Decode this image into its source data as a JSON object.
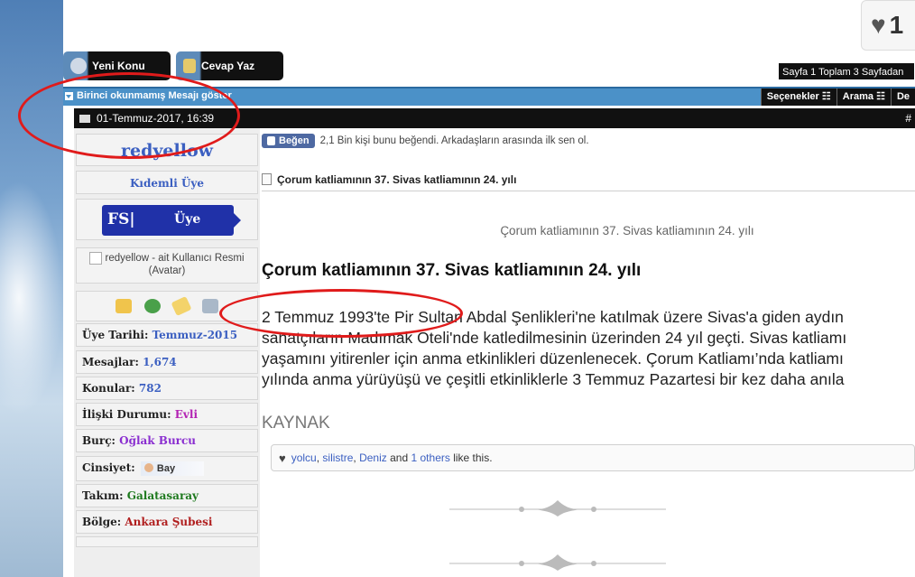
{
  "top_widget": {
    "icon": "heart-icon",
    "count": "1"
  },
  "toolbar": {
    "new_thread": "Yeni Konu",
    "reply": "Cevap Yaz"
  },
  "pagination": "Sayfa 1 Toplam 3 Sayfadan",
  "navbar": {
    "first_unread": "Birinci okunmamış Mesajı göster",
    "tools": [
      "Seçenekler",
      "Arama",
      "De"
    ]
  },
  "post": {
    "date": "01-Temmuz-2017, 16:39",
    "hash": "#"
  },
  "user": {
    "name": "redyellow",
    "title": "Kıdemli Üye",
    "rank_left": "FS|",
    "rank_right": "Üye",
    "avatar_alt": "redyellow - ait Kullanıcı Resmi (Avatar)",
    "info": [
      {
        "label": "Üye Tarihi:",
        "value": "Temmuz-2015"
      },
      {
        "label": "Mesajlar:",
        "value": "1,674"
      },
      {
        "label": "Konular:",
        "value": "782"
      },
      {
        "label": "İlişki Durumu:",
        "value": "Evli"
      },
      {
        "label": "Burç:",
        "value": "Oğlak Burcu"
      },
      {
        "label": "Cinsiyet:",
        "value": "Bay"
      },
      {
        "label": "Takım:",
        "value": "Galatasaray"
      },
      {
        "label": "Bölge:",
        "value": "Ankara Şubesi"
      }
    ]
  },
  "content": {
    "fb_button": "Beğen",
    "fb_text": "2,1 Bin kişi bunu beğendi. Arkadaşların arasında ilk sen ol.",
    "thread_title": "Çorum katliamının 37. Sivas katliamının 24. yılı",
    "image_caption": "Çorum katliamının 37. Sivas katliamının 24. yılı",
    "headline": "Çorum katliamının 37. Sivas katliamının 24. yılı",
    "paragraph_lines": [
      "2 Temmuz 1993'te Pir Sultan Abdal Şenlikleri'ne katılmak üzere Sivas'a giden aydın",
      "sanatçıların Madımak Oteli'nde katledilmesinin üzerinden 24 yıl geçti. Sivas katliamı",
      "yaşamını yitirenler için anma etkinlikleri düzenlenecek. Çorum Katliamı’nda katliamı",
      "yılında anma yürüyüşü ve çeşitli etkinliklerle 3 Temmuz Pazartesi bir kez daha anıla"
    ],
    "source_label": "KAYNAK",
    "likes": {
      "users": [
        "yolcu",
        "silistre",
        "Deniz"
      ],
      "and1": "and",
      "others": "1 others",
      "suffix": "like this."
    }
  },
  "colors": {
    "annotation": "#e01b1b",
    "navbar": "#4b91c8",
    "link": "#3b5fc1"
  }
}
